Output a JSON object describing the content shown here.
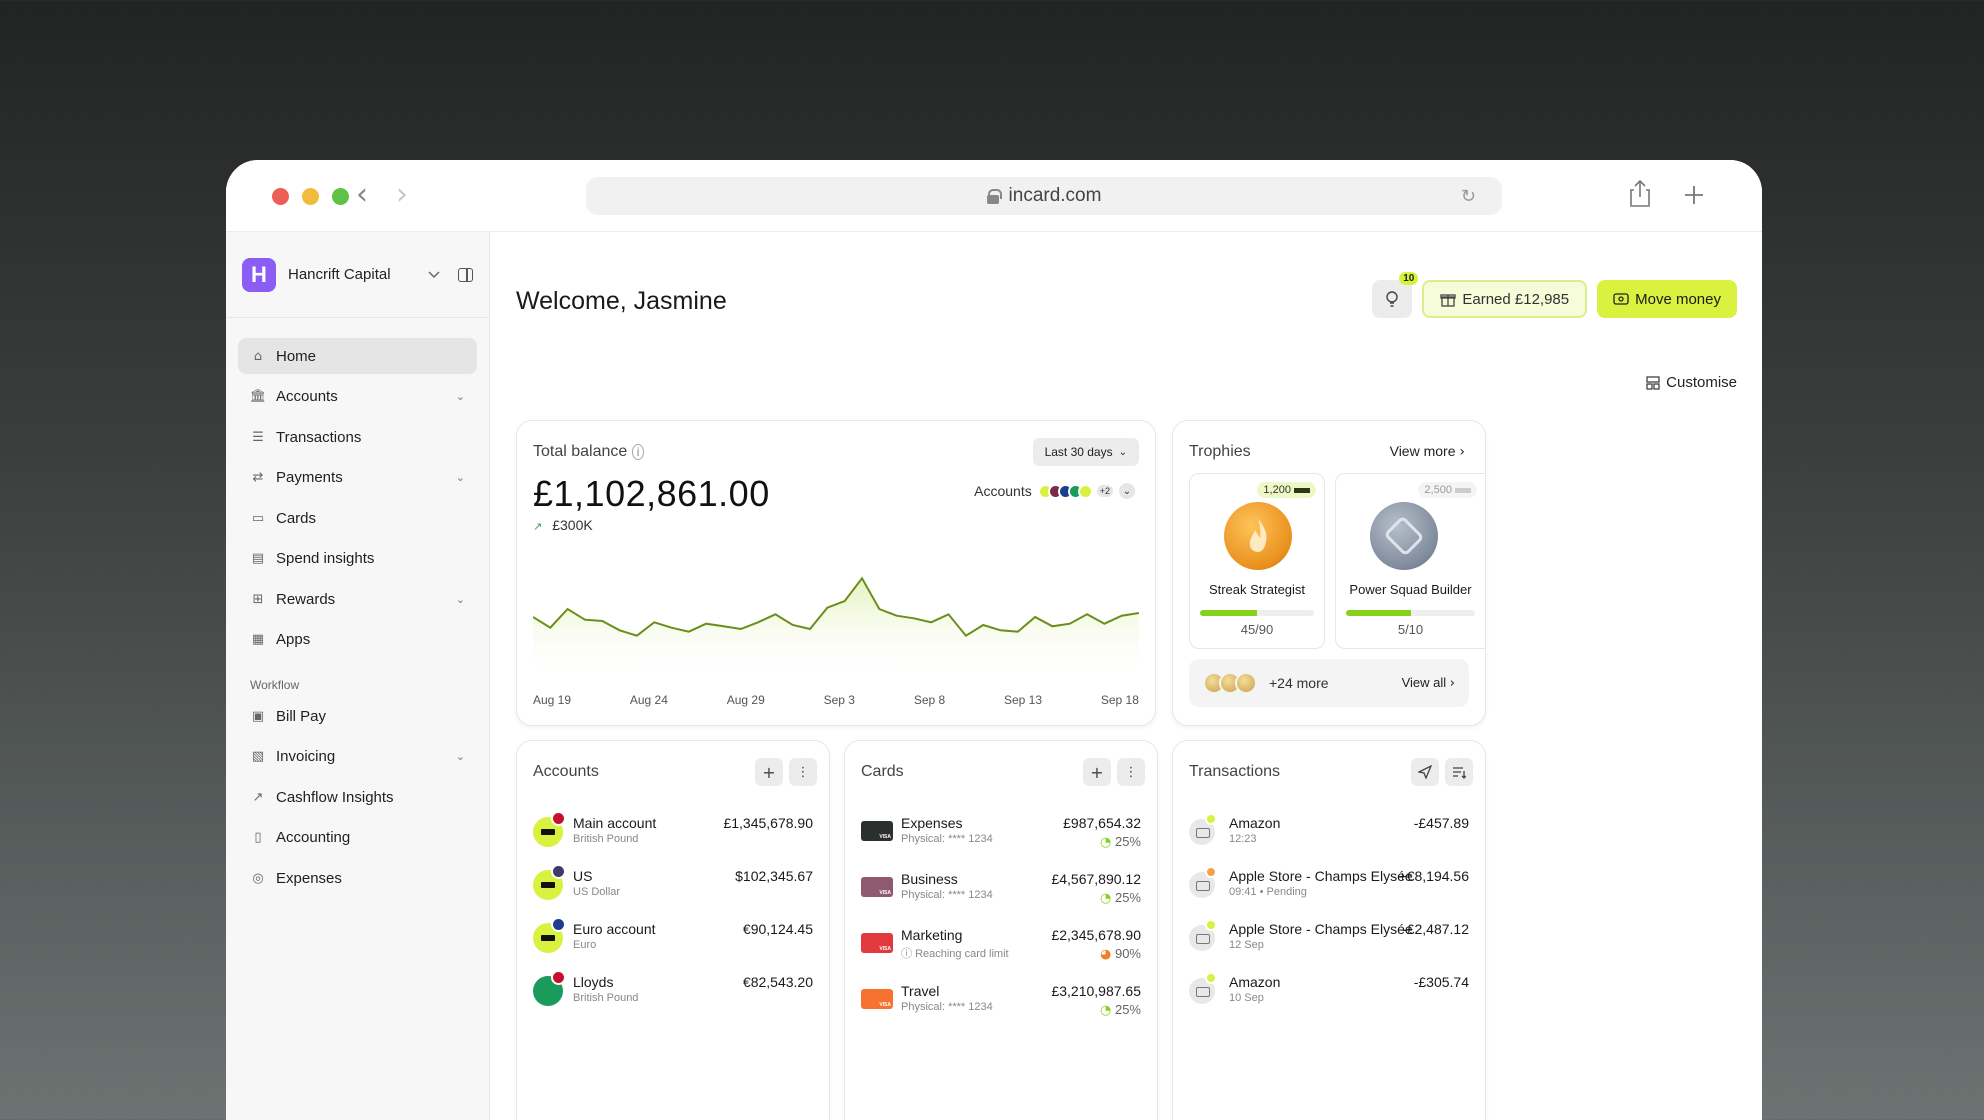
{
  "browser": {
    "url": "incard.com"
  },
  "sidebar": {
    "org_initial": "H",
    "org_name": "Hancrift Capital",
    "items": [
      {
        "label": "Home",
        "icon": "home-icon"
      },
      {
        "label": "Accounts",
        "icon": "bank-icon"
      },
      {
        "label": "Transactions",
        "icon": "list-icon"
      },
      {
        "label": "Payments",
        "icon": "transfer-icon"
      },
      {
        "label": "Cards",
        "icon": "card-icon"
      },
      {
        "label": "Spend insights",
        "icon": "chart-icon"
      },
      {
        "label": "Rewards",
        "icon": "gift-icon"
      },
      {
        "label": "Apps",
        "icon": "grid-icon"
      }
    ],
    "workflow_label": "Workflow",
    "workflow_items": [
      {
        "label": "Bill Pay",
        "icon": "bill-icon"
      },
      {
        "label": "Invoicing",
        "icon": "invoice-icon"
      },
      {
        "label": "Cashflow Insights",
        "icon": "trend-icon"
      },
      {
        "label": "Accounting",
        "icon": "book-icon"
      },
      {
        "label": "Expenses",
        "icon": "expense-icon"
      }
    ]
  },
  "header": {
    "welcome": "Welcome, Jasmine",
    "notif_count": "10",
    "earned": "Earned £12,985",
    "move_money": "Move money",
    "customise": "Customise"
  },
  "balance": {
    "title": "Total balance",
    "amount": "£1,102,861.00",
    "change": "£300K",
    "range": "Last 30 days",
    "accounts_label": "Accounts",
    "accounts_more": "+2"
  },
  "chart_data": {
    "type": "area",
    "x_labels": [
      "Aug 19",
      "Aug 24",
      "Aug 29",
      "Sep 3",
      "Sep 8",
      "Sep 13",
      "Sep 18"
    ],
    "values": [
      48,
      40,
      54,
      46,
      45,
      38,
      34,
      44,
      40,
      37,
      43,
      41,
      39,
      44,
      50,
      42,
      39,
      55,
      60,
      77,
      54,
      49,
      47,
      44,
      50,
      34,
      42,
      38,
      37,
      48,
      41,
      43,
      50,
      43,
      49,
      51
    ],
    "color": "#6b8e1a"
  },
  "trophies": {
    "title": "Trophies",
    "view_more": "View more",
    "items": [
      {
        "name": "Streak Strategist",
        "points": "1,200",
        "progress": "45/90",
        "fraction": 0.5
      },
      {
        "name": "Power Squad Builder",
        "points": "2,500",
        "progress": "5/10",
        "fraction": 0.5
      }
    ],
    "more": "+24 more",
    "view_all": "View all"
  },
  "accounts": {
    "title": "Accounts",
    "rows": [
      {
        "name": "Main account",
        "sub": "British Pound",
        "amount": "£1,345,678.90"
      },
      {
        "name": "US",
        "sub": "US Dollar",
        "amount": "$102,345.67"
      },
      {
        "name": "Euro account",
        "sub": "Euro",
        "amount": "€90,124.45"
      },
      {
        "name": "Lloyds",
        "sub": "British Pound",
        "amount": "€82,543.20"
      }
    ]
  },
  "cards": {
    "title": "Cards",
    "rows": [
      {
        "name": "Expenses",
        "sub": "Physical: **** 1234",
        "amount": "£987,654.32",
        "pct": "25%",
        "color": "#2b2f2e"
      },
      {
        "name": "Business",
        "sub": "Physical: **** 1234",
        "amount": "£4,567,890.12",
        "pct": "25%",
        "color": "#8d5a70"
      },
      {
        "name": "Marketing",
        "sub": "Reaching card limit",
        "amount": "£2,345,678.90",
        "pct": "90%",
        "color": "#e0393e"
      },
      {
        "name": "Travel",
        "sub": "Physical: **** 1234",
        "amount": "£3,210,987.65",
        "pct": "25%",
        "color": "#f5732f"
      }
    ]
  },
  "transactions": {
    "title": "Transactions",
    "rows": [
      {
        "name": "Amazon",
        "sub": "12:23",
        "amount": "-£457.89"
      },
      {
        "name": "Apple Store - Champs Elysée",
        "sub": "09:41",
        "status": "Pending",
        "amount": "+€8,194.56"
      },
      {
        "name": "Apple Store - Champs Elysée",
        "sub": "12 Sep",
        "amount": "-£2,487.12"
      },
      {
        "name": "Amazon",
        "sub": "10 Sep",
        "amount": "-£305.74"
      }
    ]
  }
}
